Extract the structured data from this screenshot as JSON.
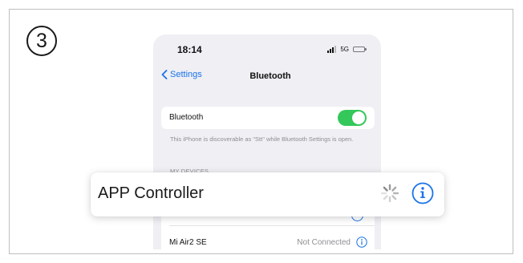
{
  "step": {
    "number": "3"
  },
  "status_bar": {
    "time": "18:14",
    "network": "5G",
    "icons": [
      "signal-icon",
      "battery-icon"
    ]
  },
  "nav": {
    "back_label": "Settings",
    "back_icon": "chevron-left-icon",
    "title": "Bluetooth"
  },
  "bluetooth": {
    "label": "Bluetooth",
    "enabled": true,
    "note": "This iPhone is discoverable as \"Stt\" while Bluetooth Settings is open."
  },
  "my_devices": {
    "header": "MY DEVICES",
    "devices": [
      {
        "name": "Mi Air2 SE",
        "status": "Not Connected",
        "icon": "info-icon"
      }
    ]
  },
  "highlighted_device": {
    "name": "APP Controller",
    "state_icon": "spinner-icon",
    "info_icon": "info-icon"
  },
  "colors": {
    "accent": "#1a73e8",
    "toggle_on": "#34c759",
    "list_background": "#efeff4"
  }
}
